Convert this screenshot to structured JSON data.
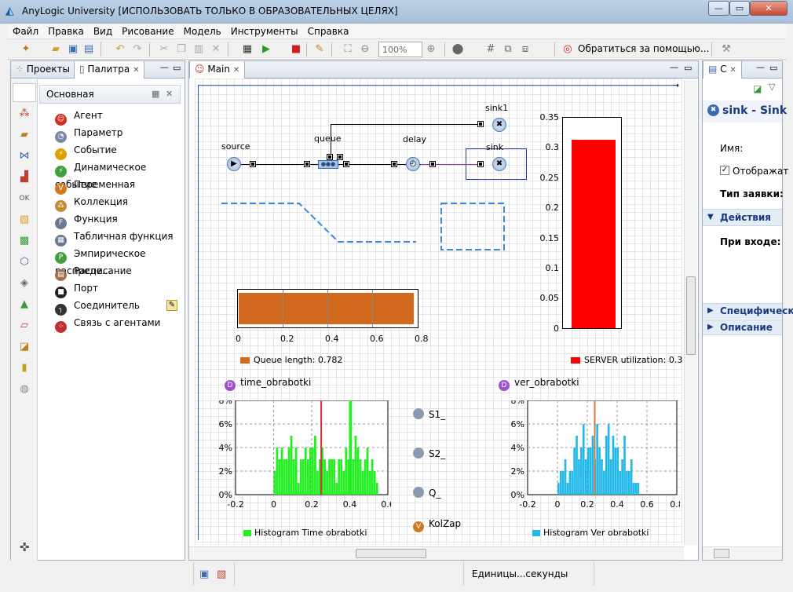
{
  "window": {
    "title": "AnyLogic University [ИСПОЛЬЗОВАТЬ ТОЛЬКО В ОБРАЗОВАТЕЛЬНЫХ ЦЕЛЯХ]",
    "minimize": "—",
    "maximize": "▭",
    "close": "✕"
  },
  "menu": [
    "Файл",
    "Правка",
    "Вид",
    "Рисование",
    "Модель",
    "Инструменты",
    "Справка"
  ],
  "toolbar": {
    "zoom": "100%",
    "help": "Обратиться за помощью..."
  },
  "left_panel": {
    "tabs": [
      "Проекты",
      "Палитра"
    ],
    "section": "Основная",
    "items": [
      {
        "label": "Агент",
        "color": "#d03020",
        "glyph": "☺"
      },
      {
        "label": "Параметр",
        "color": "#7a8aa0",
        "glyph": "◔"
      },
      {
        "label": "Событие",
        "color": "#e0a000",
        "glyph": "⚡"
      },
      {
        "label": "Динамическое событие",
        "color": "#40a040",
        "glyph": "⚡"
      },
      {
        "label": "Переменная",
        "color": "#d07a20",
        "glyph": "V"
      },
      {
        "label": "Коллекция",
        "color": "#c08a30",
        "glyph": "⁂"
      },
      {
        "label": "Функция",
        "color": "#6a7a90",
        "glyph": "F"
      },
      {
        "label": "Табличная функция",
        "color": "#6a7a90",
        "glyph": "▦"
      },
      {
        "label": "Эмпирическое распреде...",
        "color": "#40a040",
        "glyph": "P"
      },
      {
        "label": "Расписание",
        "color": "#a07050",
        "glyph": "▤"
      },
      {
        "label": "Порт",
        "color": "#222",
        "glyph": "■"
      },
      {
        "label": "Соединитель",
        "color": "#333",
        "glyph": "┐"
      },
      {
        "label": "Связь с агентами",
        "color": "#c03030",
        "glyph": "⁘"
      }
    ]
  },
  "editor": {
    "tab": "Main"
  },
  "diagram": {
    "source": "source",
    "queue": "queue",
    "delay": "delay",
    "sink": "sink",
    "sink1": "sink1"
  },
  "queue_chart": {
    "legend": "Queue length: 0.782",
    "value": 0.782,
    "xlim": [
      0,
      0.8
    ],
    "ticks": [
      "0",
      "0.2",
      "0.4",
      "0.6",
      "0.8"
    ],
    "color": "#d2691e"
  },
  "util_chart": {
    "legend": "SERVER utilization: 0.314",
    "value": 0.314,
    "ylim": [
      0,
      0.35
    ],
    "ticks": [
      "0.35",
      "0.3",
      "0.25",
      "0.2",
      "0.15",
      "0.1",
      "0.05",
      "0"
    ],
    "color": "#ff0000"
  },
  "hist_left": {
    "name": "time_obrabotki",
    "legend": "Histogram Time obrabotki",
    "yticks": [
      "8%",
      "6%",
      "4%",
      "2%",
      "0%"
    ],
    "xticks": [
      "-0.2",
      "0",
      "0.2",
      "0.4",
      "0.6"
    ]
  },
  "hist_right": {
    "name": "ver_obrabotki",
    "legend": "Histogram Ver obrabotki",
    "yticks": [
      "8%",
      "6%",
      "4%",
      "2%",
      "0%"
    ],
    "xticks": [
      "-0.2",
      "0",
      "0.2",
      "0.4",
      "0.6",
      "0.8"
    ]
  },
  "variables": [
    "S1_",
    "S2_",
    "Q_",
    "KolZap"
  ],
  "right_panel": {
    "tab": "С",
    "title": "sink - Sink",
    "name_label": "Имя:",
    "show_label": "Отображат",
    "type_label": "Тип заявки:",
    "actions": "Действия",
    "on_enter": "При входе:",
    "specific": "Специфически",
    "description": "Описание"
  },
  "status": {
    "units": "Единицы...секунды"
  },
  "chart_data": [
    {
      "type": "bar",
      "title": "",
      "categories": [
        "Queue length"
      ],
      "values": [
        0.782
      ],
      "xlim": [
        0,
        0.8
      ]
    },
    {
      "type": "bar",
      "title": "",
      "categories": [
        "SERVER utilization"
      ],
      "values": [
        0.314
      ],
      "ylim": [
        0,
        0.35
      ]
    },
    {
      "type": "bar",
      "title": "",
      "series": [
        {
          "name": "Histogram Time obrabotki",
          "values": [
            2,
            4,
            3,
            4,
            3,
            3,
            4,
            5,
            3,
            4,
            1,
            3,
            3,
            4,
            3,
            4,
            4,
            5,
            2,
            3,
            4,
            3,
            2,
            3,
            3,
            3,
            1,
            3,
            3,
            2,
            4,
            3,
            8,
            3,
            5,
            4,
            3,
            2,
            3,
            4,
            2,
            3,
            2,
            1
          ]
        }
      ],
      "xlim": [
        -0.2,
        0.6
      ],
      "ylim": [
        0,
        8
      ]
    },
    {
      "type": "bar",
      "title": "",
      "series": [
        {
          "name": "Histogram Ver obrabotki",
          "values": [
            1,
            2,
            2,
            3,
            1,
            2,
            2,
            4,
            5,
            3,
            4,
            6,
            3,
            4,
            4,
            5,
            3,
            6,
            4,
            3,
            2,
            5,
            6,
            3,
            5,
            4,
            4,
            2,
            3,
            5,
            2,
            2,
            3,
            1,
            1,
            1
          ]
        }
      ],
      "xlim": [
        -0.2,
        0.8
      ],
      "ylim": [
        0,
        8
      ]
    }
  ]
}
